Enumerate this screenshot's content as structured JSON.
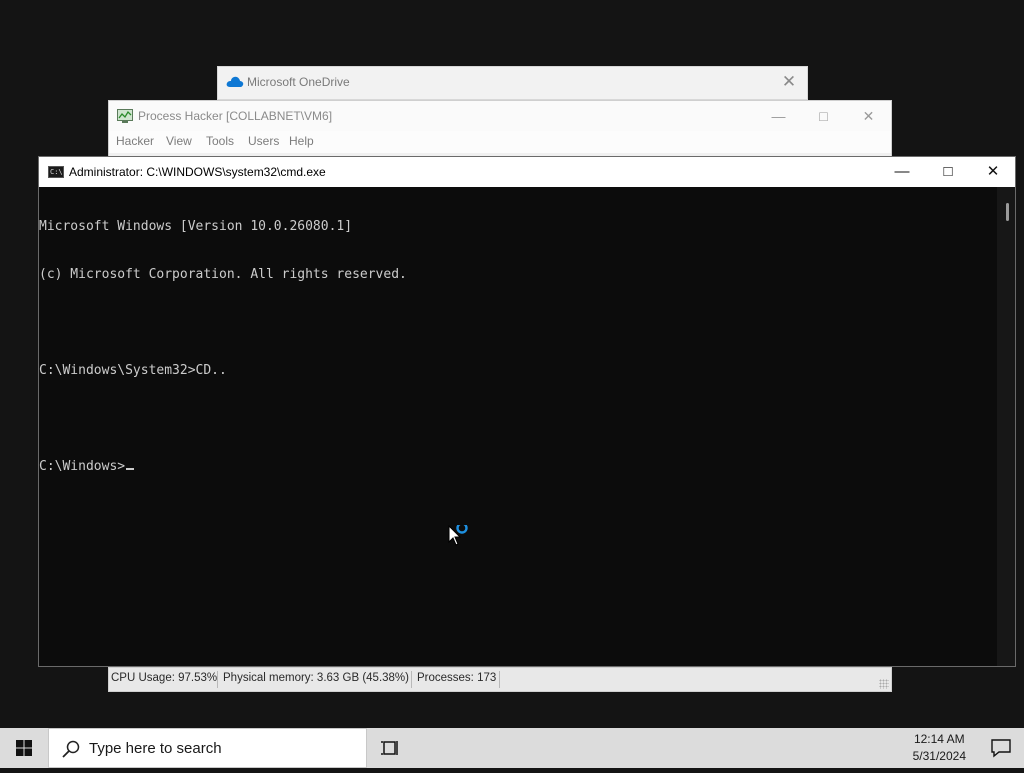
{
  "onedrive": {
    "title": "Microsoft OneDrive",
    "close_label": "✕"
  },
  "process_hacker": {
    "title": "Process Hacker [COLLABNET\\VM6]",
    "menu": [
      "Hacker",
      "View",
      "Tools",
      "Users",
      "Help"
    ],
    "status": {
      "cpu": "CPU Usage: 97.53%",
      "memory": "Physical memory: 3.63 GB (45.38%)",
      "processes": "Processes: 173"
    }
  },
  "cmd": {
    "title": "Administrator: C:\\WINDOWS\\system32\\cmd.exe",
    "icon_text": "C:\\",
    "lines": [
      "Microsoft Windows [Version 10.0.26080.1]",
      "(c) Microsoft Corporation. All rights reserved.",
      "",
      "C:\\Windows\\System32>CD..",
      ""
    ],
    "prompt": "C:\\Windows>"
  },
  "taskbar": {
    "search_placeholder": "Type here to search",
    "time": "12:14 AM",
    "date": "5/31/2024"
  },
  "colors": {
    "desktop": "#141414",
    "console_bg": "#0c0c0c",
    "console_text": "#cccccc",
    "onedrive_blue": "#0f78d4",
    "busy_ring": "#1e90e0"
  },
  "icons": [
    "onedrive-cloud-icon",
    "process-hacker-icon",
    "cmd-icon",
    "minimize-icon",
    "maximize-icon",
    "close-icon",
    "windows-start-icon",
    "search-icon",
    "task-view-icon",
    "notification-icon",
    "busy-pointer-icon"
  ]
}
